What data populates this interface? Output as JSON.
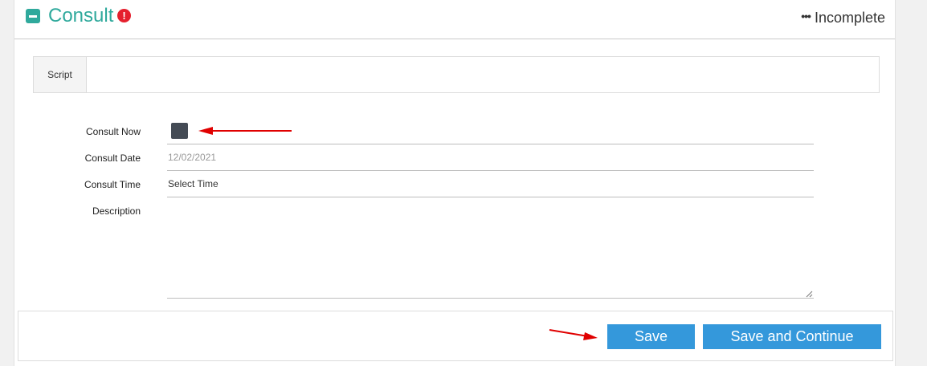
{
  "header": {
    "title": "Consult",
    "status": "Incomplete",
    "status_icon": "ellipsis-icon",
    "alert_icon": "exclamation-circle-icon",
    "accent_color": "#2fa99c",
    "alert_color": "#e5202e"
  },
  "script": {
    "tab_label": "Script",
    "content": ""
  },
  "form": {
    "consult_now": {
      "label": "Consult Now",
      "checked": true
    },
    "consult_date": {
      "label": "Consult Date",
      "value": "12/02/2021"
    },
    "consult_time": {
      "label": "Consult Time",
      "value": "Select Time"
    },
    "description": {
      "label": "Description",
      "value": ""
    }
  },
  "footer": {
    "save_label": "Save",
    "save_continue_label": "Save and Continue",
    "button_color": "#3498db"
  },
  "annotations": {
    "arrow_color": "#e00000"
  }
}
